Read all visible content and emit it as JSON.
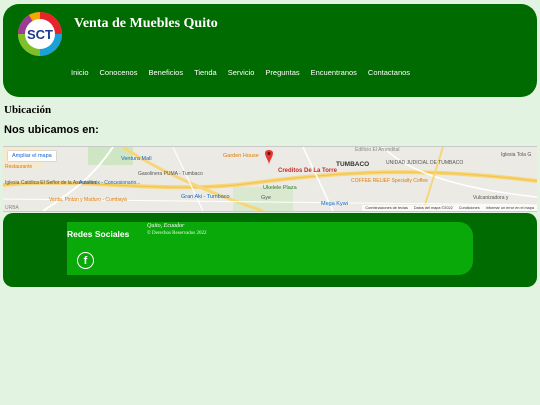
{
  "header": {
    "logo_text": "SCT",
    "site_title": "Venta de Muebles Quito",
    "nav": [
      "Inicio",
      "Conocenos",
      "Beneficios",
      "Tienda",
      "Servicio",
      "Preguntas",
      "Encuentranos",
      "Contactanos"
    ]
  },
  "main": {
    "section_title": "Ubicación",
    "find_title": "Nos ubicamos en:"
  },
  "map": {
    "enlarge_label": "Ampliar el mapa",
    "pin_label": "Creditos De La Torre",
    "places": [
      "Ventura Mall",
      "Garden House",
      "TUMBACO",
      "UNIDAD JUDICIAL DE TUMBACO",
      "Iglesia Tola G",
      "Gasolinera PUMA - Tumbaco",
      "Autofenix - Concesionario...",
      "Ukelele Plaza",
      "COFFEE RELIEF Specialty Coffee",
      "Gran Aki - Tumbaco",
      "Vulcanizadora y",
      "Venta, Pintan y Maduro - Cumbayá",
      "Mega Kywi",
      "Iglesia Católica El Señor de la Ascensión",
      "Gye",
      "Restaurante",
      "Edificio El Arrendital",
      "URBA"
    ],
    "attribution": [
      "Combinaciones de teclas",
      "Datos del mapa ©2022",
      "Condiciones",
      "Informar un error en el mapa"
    ]
  },
  "footer": {
    "social_title": "Redes Sociales",
    "facebook_glyph": "f",
    "location_text": "Quito, Ecuador",
    "copyright": "© Derechos Reservados 2022"
  },
  "colors": {
    "primary_green": "#006b00",
    "accent_green": "#0aa90a",
    "page_bg": "#e3f3e1",
    "map_pin": "#e53935"
  }
}
